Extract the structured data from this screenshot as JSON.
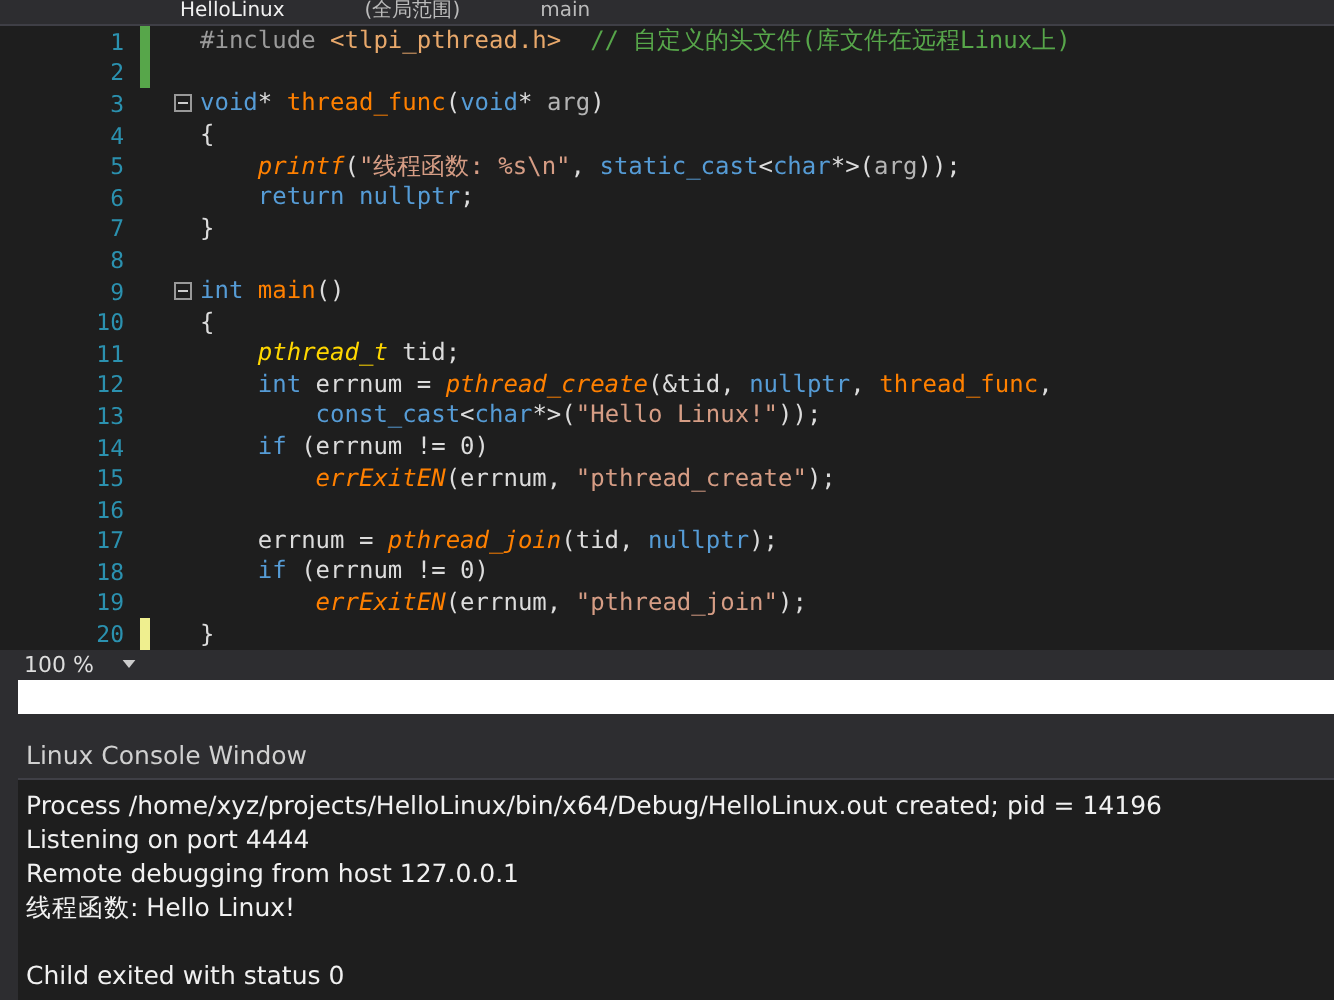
{
  "tabs": [
    {
      "label": "HelloLinux",
      "selected": true
    },
    {
      "label": "(全局范围)",
      "selected": false
    },
    {
      "label": "main",
      "selected": false
    }
  ],
  "editor": {
    "lines": [
      {
        "number": "1",
        "changed": true,
        "saved": true,
        "fold": false,
        "segments": [
          {
            "kind": "preproc",
            "text": "#include "
          },
          {
            "kind": "include",
            "text": "<tlpi_pthread.h>"
          },
          {
            "kind": "comment",
            "text": "  // 自定义的头文件(库文件在远程Linux上)"
          }
        ]
      },
      {
        "number": "2",
        "changed": true,
        "saved": true,
        "fold": false
      },
      {
        "number": "3",
        "changed": false,
        "fold": true,
        "segments": [
          {
            "kind": "keyword",
            "text": "void"
          },
          {
            "kind": "plain",
            "text": "* "
          },
          {
            "kind": "function",
            "text": "thread_func"
          },
          {
            "kind": "plain",
            "text": "("
          },
          {
            "kind": "keyword",
            "text": "void"
          },
          {
            "kind": "plain",
            "text": "* "
          },
          {
            "kind": "param",
            "text": "arg"
          },
          {
            "kind": "plain",
            "text": ")"
          }
        ]
      },
      {
        "number": "4",
        "changed": false,
        "fold": false,
        "segments": [
          {
            "kind": "plain",
            "text": "{"
          }
        ]
      },
      {
        "number": "5",
        "changed": false,
        "fold": false,
        "segments": [
          {
            "kind": "macro",
            "text": "    printf"
          },
          {
            "kind": "plain",
            "text": "("
          },
          {
            "kind": "string",
            "text": "\"线程函数: %s\\n\""
          },
          {
            "kind": "plain",
            "text": ", "
          },
          {
            "kind": "keyword",
            "text": "static_cast"
          },
          {
            "kind": "plain",
            "text": "<"
          },
          {
            "kind": "keyword",
            "text": "char"
          },
          {
            "kind": "plain",
            "text": "*>("
          },
          {
            "kind": "param",
            "text": "arg"
          },
          {
            "kind": "plain",
            "text": "));"
          }
        ]
      },
      {
        "number": "6",
        "changed": false,
        "fold": false,
        "segments": [
          {
            "kind": "keyword",
            "text": "    return nullptr"
          },
          {
            "kind": "plain",
            "text": ";"
          }
        ]
      },
      {
        "number": "7",
        "changed": false,
        "fold": false,
        "segments": [
          {
            "kind": "plain",
            "text": "}"
          }
        ]
      },
      {
        "number": "8",
        "changed": false,
        "fold": false
      },
      {
        "number": "9",
        "changed": false,
        "fold": true,
        "segments": [
          {
            "kind": "keyword",
            "text": "int"
          },
          {
            "kind": "function",
            "text": " main"
          },
          {
            "kind": "plain",
            "text": "()"
          }
        ]
      },
      {
        "number": "10",
        "changed": false,
        "fold": false,
        "segments": [
          {
            "kind": "plain",
            "text": "{"
          }
        ]
      },
      {
        "number": "11",
        "changed": false,
        "fold": false,
        "segments": [
          {
            "kind": "type",
            "text": "    pthread_t"
          },
          {
            "kind": "plain",
            "text": " tid;"
          }
        ]
      },
      {
        "number": "12",
        "changed": false,
        "fold": false,
        "segments": [
          {
            "kind": "keyword",
            "text": "    int"
          },
          {
            "kind": "plain",
            "text": " errnum = "
          },
          {
            "kind": "macro",
            "text": "pthread_create"
          },
          {
            "kind": "plain",
            "text": "(&tid, "
          },
          {
            "kind": "keyword",
            "text": "nullptr"
          },
          {
            "kind": "plain",
            "text": ", "
          },
          {
            "kind": "function",
            "text": "thread_func"
          },
          {
            "kind": "plain",
            "text": ","
          }
        ]
      },
      {
        "number": "13",
        "changed": false,
        "fold": false,
        "segments": [
          {
            "kind": "keyword",
            "text": "        const_cast"
          },
          {
            "kind": "plain",
            "text": "<"
          },
          {
            "kind": "keyword",
            "text": "char"
          },
          {
            "kind": "plain",
            "text": "*>("
          },
          {
            "kind": "string",
            "text": "\"Hello Linux!\""
          },
          {
            "kind": "plain",
            "text": "));"
          }
        ]
      },
      {
        "number": "14",
        "changed": false,
        "fold": false,
        "segments": [
          {
            "kind": "keyword",
            "text": "    if"
          },
          {
            "kind": "plain",
            "text": " (errnum != 0)"
          }
        ]
      },
      {
        "number": "15",
        "changed": false,
        "fold": false,
        "segments": [
          {
            "kind": "macro",
            "text": "        errExitEN"
          },
          {
            "kind": "plain",
            "text": "(errnum, "
          },
          {
            "kind": "string",
            "text": "\"pthread_create\""
          },
          {
            "kind": "plain",
            "text": ");"
          }
        ]
      },
      {
        "number": "16",
        "changed": false,
        "fold": false
      },
      {
        "number": "17",
        "changed": false,
        "fold": false,
        "segments": [
          {
            "kind": "plain",
            "text": "    errnum = "
          },
          {
            "kind": "macro",
            "text": "pthread_join"
          },
          {
            "kind": "plain",
            "text": "(tid, "
          },
          {
            "kind": "keyword",
            "text": "nullptr"
          },
          {
            "kind": "plain",
            "text": ");"
          }
        ]
      },
      {
        "number": "18",
        "changed": false,
        "fold": false,
        "segments": [
          {
            "kind": "keyword",
            "text": "    if"
          },
          {
            "kind": "plain",
            "text": " (errnum != 0)"
          }
        ]
      },
      {
        "number": "19",
        "changed": false,
        "fold": false,
        "segments": [
          {
            "kind": "macro",
            "text": "        errExitEN"
          },
          {
            "kind": "plain",
            "text": "(errnum, "
          },
          {
            "kind": "string",
            "text": "\"pthread_join\""
          },
          {
            "kind": "plain",
            "text": ");"
          }
        ]
      },
      {
        "number": "20",
        "changed": true,
        "saved": false,
        "fold": false,
        "segments": [
          {
            "kind": "plain",
            "text": "}"
          }
        ]
      }
    ]
  },
  "zoom": {
    "value": "100 %"
  },
  "console": {
    "title": "Linux Console Window",
    "blocks": [
      {
        "lines": [
          "Process /home/xyz/projects/HelloLinux/bin/x64/Debug/HelloLinux.out created; pid = 14196",
          "Listening on port 4444",
          "Remote debugging from host 127.0.0.1",
          "线程函数: Hello Linux!"
        ]
      },
      {
        "lines": [
          "Child exited with status 0"
        ]
      }
    ]
  }
}
